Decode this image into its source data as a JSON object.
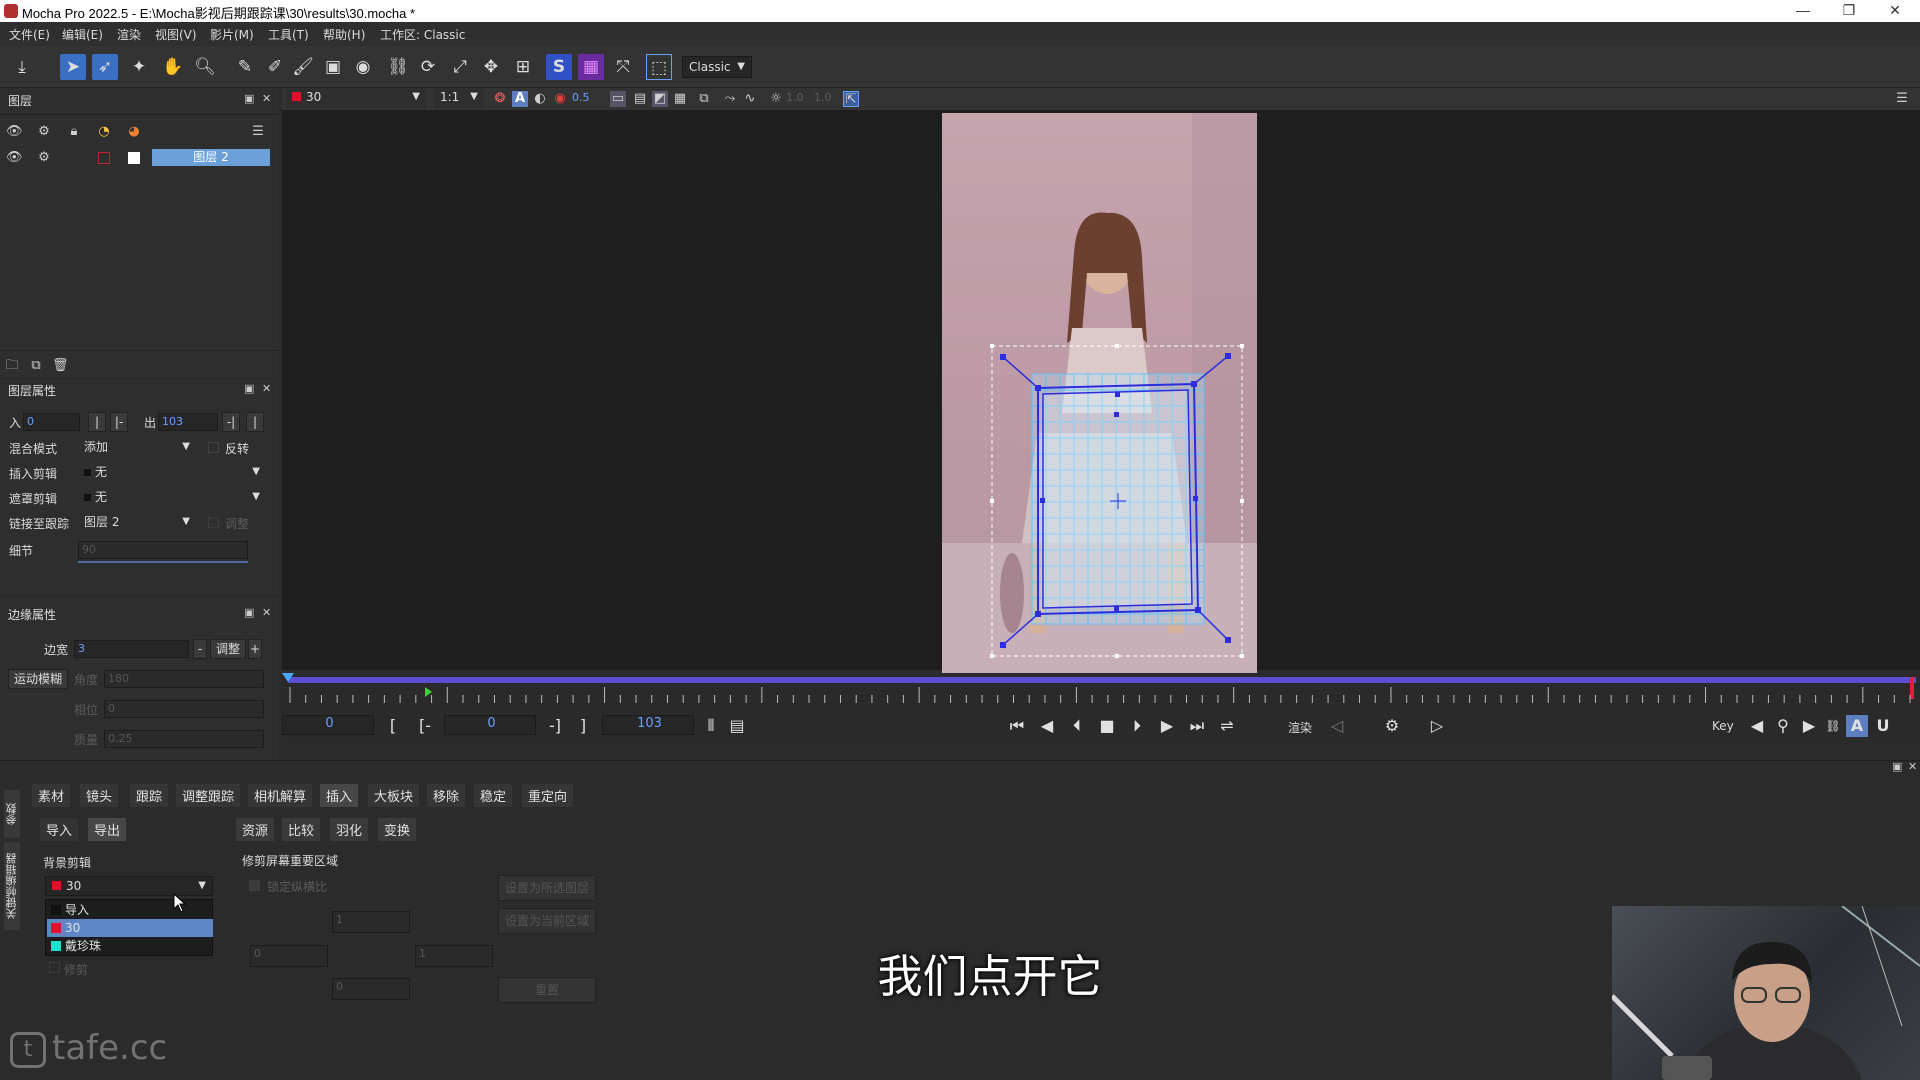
{
  "window": {
    "title": "Mocha Pro 2022.5 - E:\\Mocha影视后期跟踪课\\30\\results\\30.mocha *",
    "controls": [
      "—",
      "❐",
      "✕"
    ]
  },
  "menubar": {
    "items": [
      "文件(E)",
      "编辑(E)",
      "渲染",
      "视图(V)",
      "影片(M)",
      "工具(T)",
      "帮助(H)",
      "工作区: Classic"
    ]
  },
  "toolbar": {
    "workspace_select": "Classic"
  },
  "viewer_toolbar": {
    "clip_select": "30",
    "zoom_select": "1:1",
    "opacity_value": "0.5",
    "val_a": "1.0",
    "val_b": "1.0"
  },
  "layers_panel": {
    "title": "图层",
    "layer_name": "图层 2"
  },
  "layer_props": {
    "title": "图层属性",
    "in_label": "入",
    "in_value": "0",
    "out_label": "出",
    "out_value": "103",
    "blend_label": "混合模式",
    "blend_value": "添加",
    "invert_label": "反转",
    "insert_clip_label": "插入剪辑",
    "insert_clip_value": "无",
    "matte_clip_label": "遮罩剪辑",
    "matte_clip_value": "无",
    "link_track_label": "链接至跟踪",
    "link_track_value": "图层 2",
    "adjust_label": "调整",
    "detail_label": "细节",
    "detail_value": "90"
  },
  "edge_props": {
    "title": "边缘属性",
    "edge_width_label": "边宽",
    "edge_width_value": "3",
    "adjust_btn": "调整",
    "motion_blur_btn": "运动模糊",
    "angle_label": "角度",
    "angle_value": "180",
    "phase_label": "相位",
    "phase_value": "0",
    "quality_label": "质量",
    "quality_value": "0.25"
  },
  "timeline": {
    "current_frame": "0",
    "in_frame": "0",
    "out_frame": "103",
    "render_label": "渲染",
    "key_label": "Key"
  },
  "bottom_panel": {
    "side_tab_1": "参数",
    "side_tab_2": "关键帧编辑器",
    "tabs": [
      "素材",
      "镜头",
      "跟踪",
      "调整跟踪",
      "相机解算",
      "插入",
      "大板块",
      "移除",
      "稳定",
      "重定向"
    ],
    "sub_left": [
      "导入",
      "导出"
    ],
    "sub_right": [
      "资源",
      "比较",
      "羽化",
      "变换"
    ],
    "bg_clip_label": "背景剪辑",
    "bg_clip_value": "30",
    "dropdown_items": [
      "导入",
      "30",
      "戴珍珠"
    ],
    "trim_label": "修剪屏幕重要区域",
    "lock_aspect_label": "锁定纵横比",
    "set_from_layer_btn": "设置为所选图层",
    "set_from_cur_btn": "设置为当前区域",
    "reset_btn": "重置",
    "field_1": "1",
    "field_0a": "0",
    "field_1b": "1",
    "field_0b": "0",
    "checkbox_label": "修剪"
  },
  "overlay": {
    "subtitle": "我们点开它",
    "watermark": "tafe.cc"
  },
  "colors": {
    "accent": "#3a6fc4",
    "timeline_bar": "#5a4fd0",
    "track_blue": "#2d2ddf",
    "grid_cyan": "#4fc8ff",
    "clip_red": "#e0102a"
  }
}
